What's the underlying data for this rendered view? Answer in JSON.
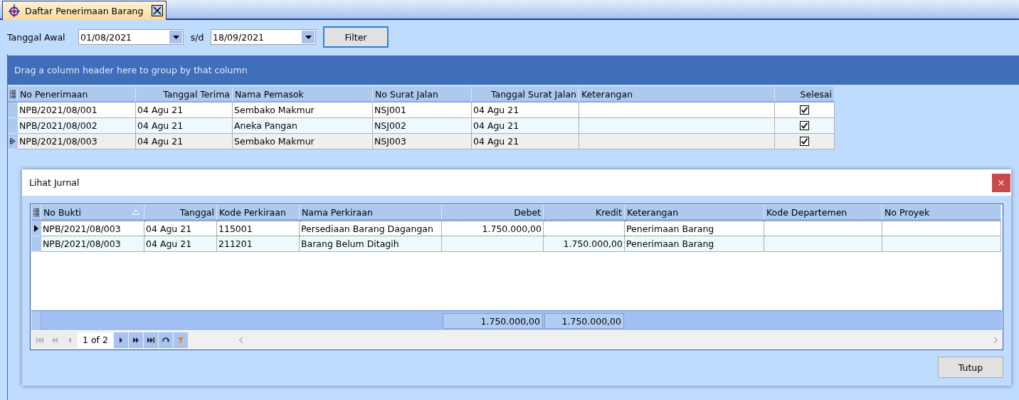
{
  "tab": {
    "title": "Daftar Penerimaan Barang",
    "selected": true
  },
  "filter": {
    "start_label": "Tanggal Awal",
    "start_value": "01/08/2021",
    "separator": "s/d",
    "end_value": "18/09/2021",
    "button": "Filter"
  },
  "group_panel": "Drag a column header here to group by that column",
  "table": {
    "columns": [
      {
        "label": "No Penerimaan",
        "right_aligned": false
      },
      {
        "label": "Tanggal Terima",
        "right_aligned": true
      },
      {
        "label": "Nama Pemasok",
        "right_aligned": false
      },
      {
        "label": "No Surat Jalan",
        "right_aligned": false
      },
      {
        "label": "Tanggal Surat Jalan",
        "right_aligned": true
      },
      {
        "label": "Keterangan",
        "right_aligned": false
      },
      {
        "label": "Selesai",
        "right_aligned": true
      }
    ],
    "rows": [
      {
        "cells": [
          "NPB/2021/08/001",
          "04 Agu 21",
          "Sembako Makmur",
          "NSJ001",
          "04 Agu 21"
        ],
        "done": true,
        "selected": false
      },
      {
        "cells": [
          "NPB/2021/08/002",
          "04 Agu 21",
          "Aneka Pangan",
          "NSJ002",
          "04 Agu 21"
        ],
        "done": true,
        "selected": false
      },
      {
        "cells": [
          "NPB/2021/08/003",
          "04 Agu 21",
          "Sembako Makmur",
          "NSJ003",
          "04 Agu 21"
        ],
        "done": true,
        "selected": true
      }
    ]
  },
  "dialog": {
    "title": "Lihat Jurnal",
    "close": "×",
    "columns": [
      {
        "label": "No Bukti",
        "right_aligned": false,
        "sorted_ascending": true
      },
      {
        "label": "Tanggal",
        "right_aligned": true
      },
      {
        "label": "Kode Perkiraan",
        "right_aligned": false
      },
      {
        "label": "Nama Perkiraan",
        "right_aligned": false
      },
      {
        "label": "Debet",
        "right_aligned": true,
        "total": "1.750.000,00"
      },
      {
        "label": "Kredit",
        "right_aligned": true,
        "total": "1.750.000,00"
      },
      {
        "label": "Keterangan",
        "right_aligned": false
      },
      {
        "label": "Kode Departemen",
        "right_aligned": false
      },
      {
        "label": "No Proyek",
        "right_aligned": false
      }
    ],
    "rows": [
      {
        "cells": [
          "NPB/2021/08/003",
          "04 Agu 21",
          "115001",
          "Persediaan Barang Dagangan",
          "1.750.000,00",
          "",
          "Penerimaan Barang",
          "",
          ""
        ],
        "selected": true
      },
      {
        "cells": [
          "NPB/2021/08/003",
          "04 Agu 21",
          "211201",
          "Barang Belum Ditagih",
          "",
          "1.750.000,00",
          "Penerimaan Barang",
          "",
          ""
        ],
        "selected": false
      }
    ],
    "navigator": {
      "position": "1 of 2",
      "buttons": [
        {
          "kind": "first",
          "disabled": true
        },
        {
          "kind": "prev_page",
          "disabled": true
        },
        {
          "kind": "prev",
          "disabled": true
        },
        {
          "kind": "position"
        },
        {
          "kind": "next",
          "disabled": false
        },
        {
          "kind": "next_page",
          "disabled": false
        },
        {
          "kind": "last",
          "disabled": false
        },
        {
          "kind": "refresh",
          "disabled": false
        },
        {
          "kind": "filter",
          "disabled": false
        }
      ]
    },
    "button": "Tutup"
  }
}
